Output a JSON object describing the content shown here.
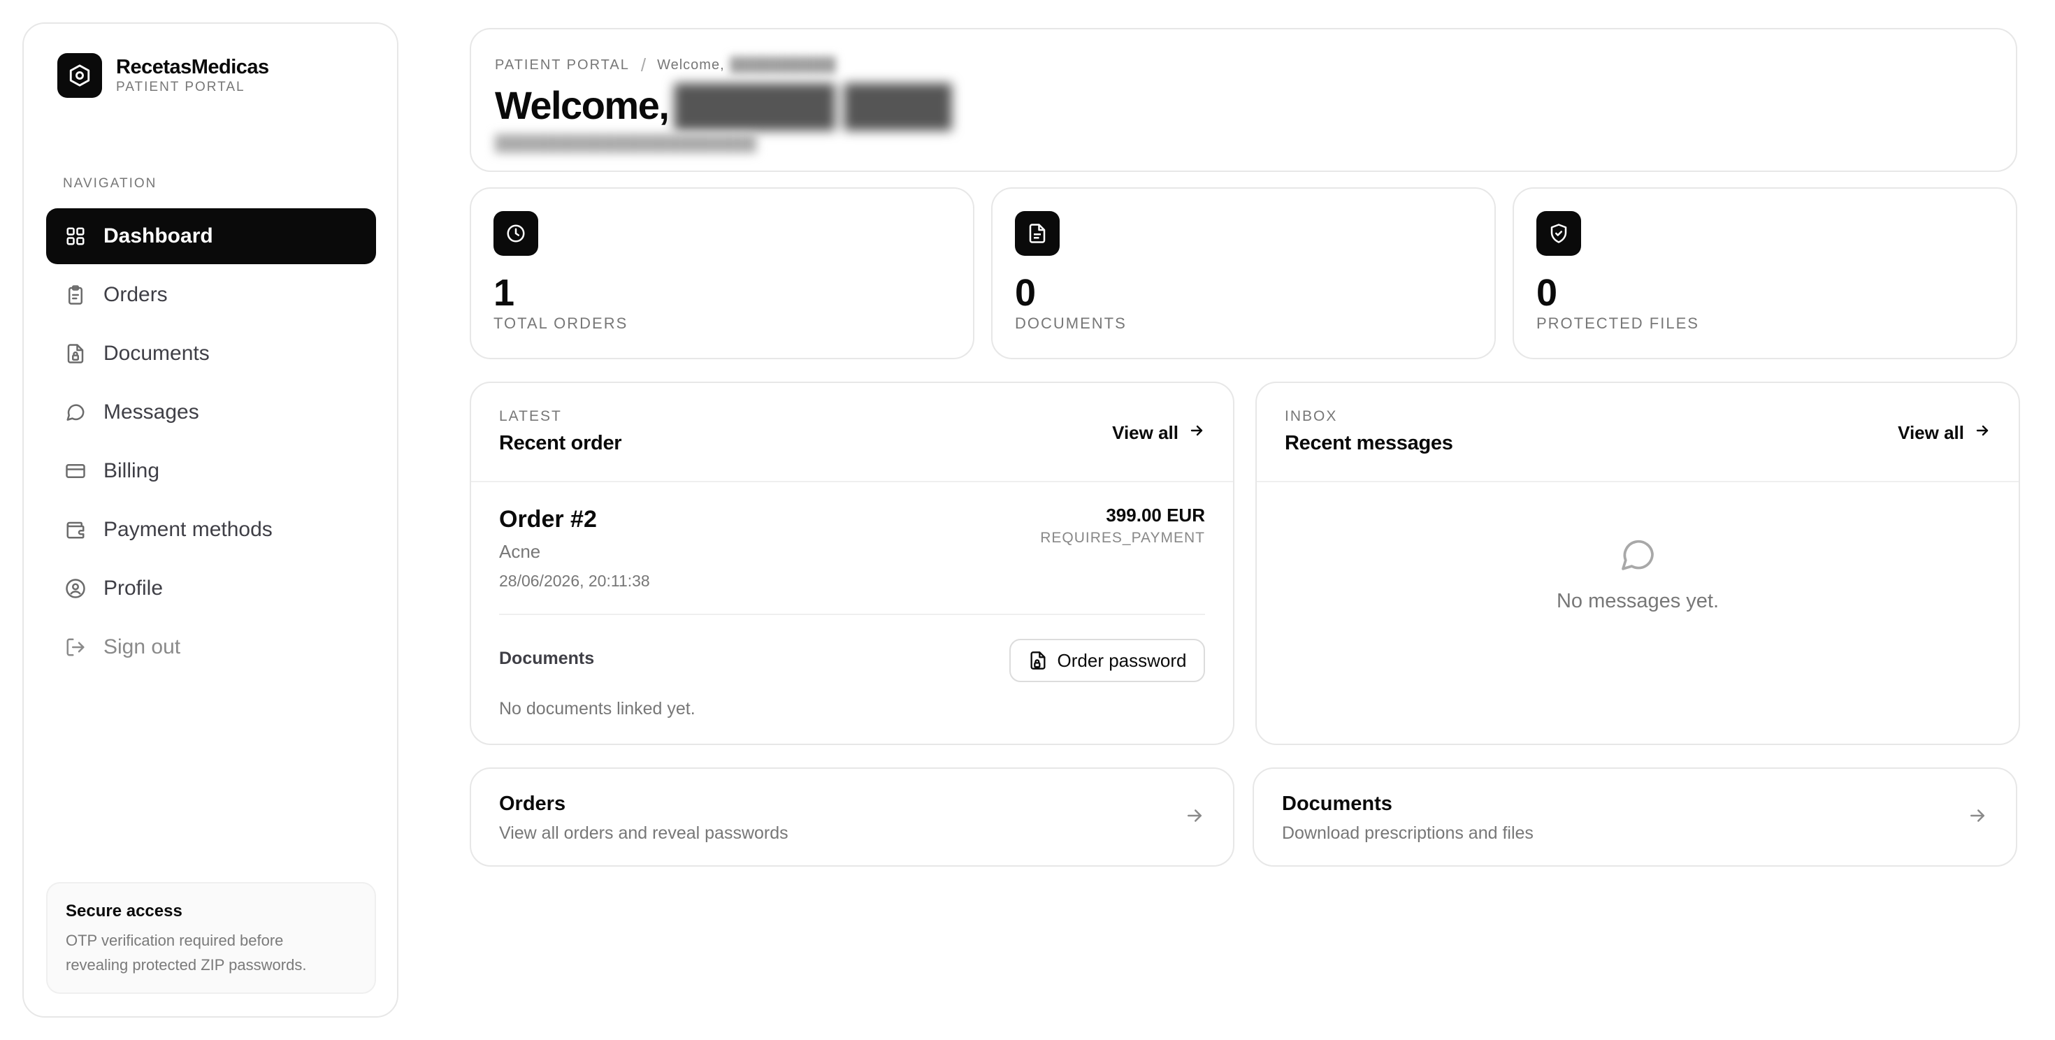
{
  "brand": {
    "name": "RecetasMedicas",
    "subtitle": "PATIENT PORTAL"
  },
  "nav": {
    "heading": "NAVIGATION",
    "items": [
      {
        "label": "Dashboard",
        "icon": "grid-icon",
        "active": true
      },
      {
        "label": "Orders",
        "icon": "clipboard-icon"
      },
      {
        "label": "Documents",
        "icon": "file-lock-icon"
      },
      {
        "label": "Messages",
        "icon": "message-circle-icon"
      },
      {
        "label": "Billing",
        "icon": "credit-card-icon"
      },
      {
        "label": "Payment methods",
        "icon": "wallet-icon"
      },
      {
        "label": "Profile",
        "icon": "user-circle-icon"
      },
      {
        "label": "Sign out",
        "icon": "log-out-icon"
      }
    ]
  },
  "secure": {
    "title": "Secure access",
    "text_line1": "OTP verification required before",
    "text_line2": "revealing protected ZIP passwords."
  },
  "header": {
    "crumb_root": "PATIENT PORTAL",
    "crumb_separator": "/",
    "crumb_welcome": "Welcome,",
    "title": "Welcome,"
  },
  "stats": [
    {
      "value": "1",
      "label": "TOTAL ORDERS",
      "icon": "clock-icon"
    },
    {
      "value": "0",
      "label": "DOCUMENTS",
      "icon": "file-text-icon"
    },
    {
      "value": "0",
      "label": "PROTECTED FILES",
      "icon": "shield-check-icon"
    }
  ],
  "recent_order": {
    "kicker": "LATEST",
    "title": "Recent order",
    "view_all": "View all",
    "order_title": "Order #2",
    "category": "Acne",
    "date": "28/06/2026, 20:11:38",
    "amount": "399.00 EUR",
    "status": "REQUIRES_PAYMENT",
    "documents_label": "Documents",
    "password_button": "Order password",
    "no_documents": "No documents linked yet."
  },
  "recent_messages": {
    "kicker": "INBOX",
    "title": "Recent messages",
    "view_all": "View all",
    "empty_text": "No messages yet."
  },
  "links": [
    {
      "title": "Orders",
      "subtitle": "View all orders and reveal passwords"
    },
    {
      "title": "Documents",
      "subtitle": "Download prescriptions and files"
    }
  ],
  "colors": {
    "primary": "#0a0a0a",
    "muted": "#777777",
    "border": "#e7e7e7",
    "background": "#ffffff"
  }
}
